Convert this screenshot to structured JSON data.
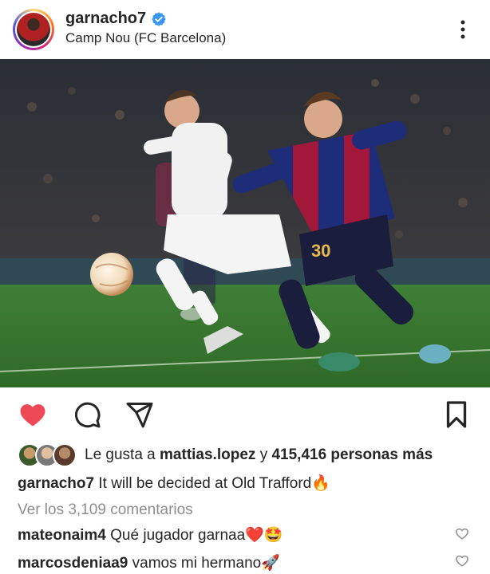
{
  "post": {
    "username": "garnacho7",
    "location": "Camp Nou (FC Barcelona)",
    "liked": true
  },
  "likes": {
    "prefix": "Le gusta a",
    "user": "mattias.lopez",
    "connector": "y",
    "count_text": "415,416 personas más"
  },
  "caption": {
    "username": "garnacho7",
    "text": "It will be decided at Old Trafford",
    "emoji": "🔥"
  },
  "comments_link": "Ver los 3,109 comentarios",
  "comments": [
    {
      "username": "mateonaim4",
      "text": "Qué jugador garnaa❤️🤩"
    },
    {
      "username": "marcosdeniaa9",
      "text": "vamos mi hermano🚀"
    }
  ],
  "colors": {
    "like_red": "#ed4956",
    "verified_blue": "#3897f0",
    "muted_text": "#8e8e8e"
  },
  "icons": [
    "verified-badge-icon",
    "more-options-icon",
    "heart-icon",
    "comment-icon",
    "share-icon",
    "bookmark-icon",
    "comment-like-icon"
  ]
}
